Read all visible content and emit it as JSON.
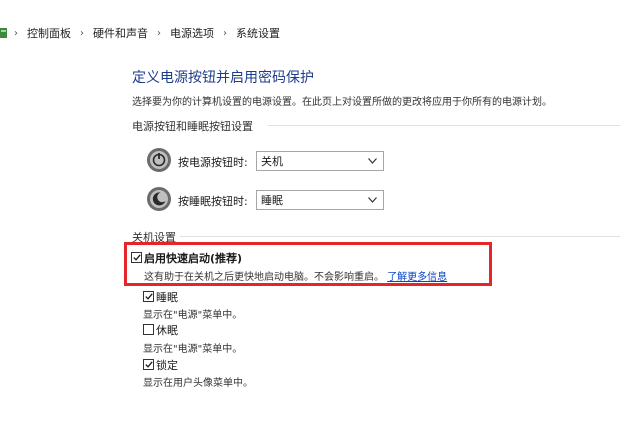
{
  "breadcrumb": {
    "items": [
      "控制面板",
      "硬件和声音",
      "电源选项",
      "系统设置"
    ],
    "separator": "›"
  },
  "header": {
    "title": "定义电源按钮并启用密码保护",
    "description": "选择要为你的计算机设置的电源设置。在此页上对设置所做的更改将应用于你所有的电源计划。"
  },
  "power_section": {
    "label": "电源按钮和睡眠按钮设置",
    "rows": [
      {
        "label": "按电源按钮时:",
        "value": "关机",
        "icon": "power-button-icon"
      },
      {
        "label": "按睡眠按钮时:",
        "value": "睡眠",
        "icon": "sleep-button-icon"
      }
    ]
  },
  "shutdown_section": {
    "label": "关机设置",
    "options": [
      {
        "label": "启用快速启动(推荐)",
        "description": "这有助于在关机之后更快地启动电脑。不会影响重启。",
        "link": "了解更多信息",
        "checked": true,
        "highlighted": true
      },
      {
        "label": "睡眠",
        "description": "显示在\"电源\"菜单中。",
        "checked": true
      },
      {
        "label": "休眠",
        "description": "显示在\"电源\"菜单中。",
        "checked": false
      },
      {
        "label": "锁定",
        "description": "显示在用户头像菜单中。",
        "checked": true
      }
    ]
  },
  "colors": {
    "title": "#1e3c8c",
    "link": "#0645c8",
    "highlight_border": "#e4262b"
  }
}
